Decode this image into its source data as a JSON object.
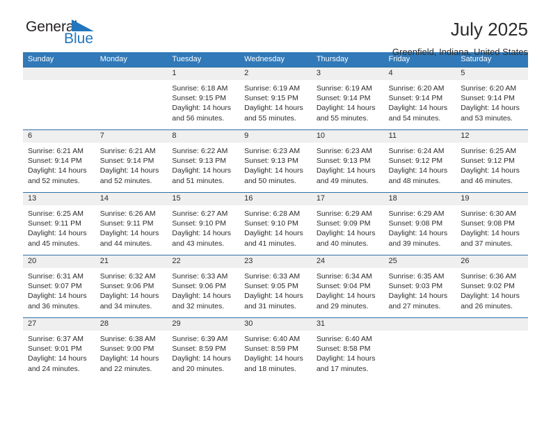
{
  "brand": {
    "name_part1": "General",
    "name_part2": "Blue",
    "triangle_icon": "triangle-icon",
    "accent_color": "#2176bd"
  },
  "header": {
    "title": "July 2025",
    "subtitle": "Greenfield, Indiana, United States"
  },
  "calendar": {
    "header_bg": "#3179b8",
    "daynum_bg": "#efefef",
    "row_border": "#2f6fa8",
    "weekday_headers": [
      "Sunday",
      "Monday",
      "Tuesday",
      "Wednesday",
      "Thursday",
      "Friday",
      "Saturday"
    ],
    "weeks": [
      [
        {
          "day": "",
          "empty": true
        },
        {
          "day": "",
          "empty": true
        },
        {
          "day": "1",
          "sunrise": "Sunrise: 6:18 AM",
          "sunset": "Sunset: 9:15 PM",
          "daylight": "Daylight: 14 hours and 56 minutes."
        },
        {
          "day": "2",
          "sunrise": "Sunrise: 6:19 AM",
          "sunset": "Sunset: 9:15 PM",
          "daylight": "Daylight: 14 hours and 55 minutes."
        },
        {
          "day": "3",
          "sunrise": "Sunrise: 6:19 AM",
          "sunset": "Sunset: 9:14 PM",
          "daylight": "Daylight: 14 hours and 55 minutes."
        },
        {
          "day": "4",
          "sunrise": "Sunrise: 6:20 AM",
          "sunset": "Sunset: 9:14 PM",
          "daylight": "Daylight: 14 hours and 54 minutes."
        },
        {
          "day": "5",
          "sunrise": "Sunrise: 6:20 AM",
          "sunset": "Sunset: 9:14 PM",
          "daylight": "Daylight: 14 hours and 53 minutes."
        }
      ],
      [
        {
          "day": "6",
          "sunrise": "Sunrise: 6:21 AM",
          "sunset": "Sunset: 9:14 PM",
          "daylight": "Daylight: 14 hours and 52 minutes."
        },
        {
          "day": "7",
          "sunrise": "Sunrise: 6:21 AM",
          "sunset": "Sunset: 9:14 PM",
          "daylight": "Daylight: 14 hours and 52 minutes."
        },
        {
          "day": "8",
          "sunrise": "Sunrise: 6:22 AM",
          "sunset": "Sunset: 9:13 PM",
          "daylight": "Daylight: 14 hours and 51 minutes."
        },
        {
          "day": "9",
          "sunrise": "Sunrise: 6:23 AM",
          "sunset": "Sunset: 9:13 PM",
          "daylight": "Daylight: 14 hours and 50 minutes."
        },
        {
          "day": "10",
          "sunrise": "Sunrise: 6:23 AM",
          "sunset": "Sunset: 9:13 PM",
          "daylight": "Daylight: 14 hours and 49 minutes."
        },
        {
          "day": "11",
          "sunrise": "Sunrise: 6:24 AM",
          "sunset": "Sunset: 9:12 PM",
          "daylight": "Daylight: 14 hours and 48 minutes."
        },
        {
          "day": "12",
          "sunrise": "Sunrise: 6:25 AM",
          "sunset": "Sunset: 9:12 PM",
          "daylight": "Daylight: 14 hours and 46 minutes."
        }
      ],
      [
        {
          "day": "13",
          "sunrise": "Sunrise: 6:25 AM",
          "sunset": "Sunset: 9:11 PM",
          "daylight": "Daylight: 14 hours and 45 minutes."
        },
        {
          "day": "14",
          "sunrise": "Sunrise: 6:26 AM",
          "sunset": "Sunset: 9:11 PM",
          "daylight": "Daylight: 14 hours and 44 minutes."
        },
        {
          "day": "15",
          "sunrise": "Sunrise: 6:27 AM",
          "sunset": "Sunset: 9:10 PM",
          "daylight": "Daylight: 14 hours and 43 minutes."
        },
        {
          "day": "16",
          "sunrise": "Sunrise: 6:28 AM",
          "sunset": "Sunset: 9:10 PM",
          "daylight": "Daylight: 14 hours and 41 minutes."
        },
        {
          "day": "17",
          "sunrise": "Sunrise: 6:29 AM",
          "sunset": "Sunset: 9:09 PM",
          "daylight": "Daylight: 14 hours and 40 minutes."
        },
        {
          "day": "18",
          "sunrise": "Sunrise: 6:29 AM",
          "sunset": "Sunset: 9:08 PM",
          "daylight": "Daylight: 14 hours and 39 minutes."
        },
        {
          "day": "19",
          "sunrise": "Sunrise: 6:30 AM",
          "sunset": "Sunset: 9:08 PM",
          "daylight": "Daylight: 14 hours and 37 minutes."
        }
      ],
      [
        {
          "day": "20",
          "sunrise": "Sunrise: 6:31 AM",
          "sunset": "Sunset: 9:07 PM",
          "daylight": "Daylight: 14 hours and 36 minutes."
        },
        {
          "day": "21",
          "sunrise": "Sunrise: 6:32 AM",
          "sunset": "Sunset: 9:06 PM",
          "daylight": "Daylight: 14 hours and 34 minutes."
        },
        {
          "day": "22",
          "sunrise": "Sunrise: 6:33 AM",
          "sunset": "Sunset: 9:06 PM",
          "daylight": "Daylight: 14 hours and 32 minutes."
        },
        {
          "day": "23",
          "sunrise": "Sunrise: 6:33 AM",
          "sunset": "Sunset: 9:05 PM",
          "daylight": "Daylight: 14 hours and 31 minutes."
        },
        {
          "day": "24",
          "sunrise": "Sunrise: 6:34 AM",
          "sunset": "Sunset: 9:04 PM",
          "daylight": "Daylight: 14 hours and 29 minutes."
        },
        {
          "day": "25",
          "sunrise": "Sunrise: 6:35 AM",
          "sunset": "Sunset: 9:03 PM",
          "daylight": "Daylight: 14 hours and 27 minutes."
        },
        {
          "day": "26",
          "sunrise": "Sunrise: 6:36 AM",
          "sunset": "Sunset: 9:02 PM",
          "daylight": "Daylight: 14 hours and 26 minutes."
        }
      ],
      [
        {
          "day": "27",
          "sunrise": "Sunrise: 6:37 AM",
          "sunset": "Sunset: 9:01 PM",
          "daylight": "Daylight: 14 hours and 24 minutes."
        },
        {
          "day": "28",
          "sunrise": "Sunrise: 6:38 AM",
          "sunset": "Sunset: 9:00 PM",
          "daylight": "Daylight: 14 hours and 22 minutes."
        },
        {
          "day": "29",
          "sunrise": "Sunrise: 6:39 AM",
          "sunset": "Sunset: 8:59 PM",
          "daylight": "Daylight: 14 hours and 20 minutes."
        },
        {
          "day": "30",
          "sunrise": "Sunrise: 6:40 AM",
          "sunset": "Sunset: 8:59 PM",
          "daylight": "Daylight: 14 hours and 18 minutes."
        },
        {
          "day": "31",
          "sunrise": "Sunrise: 6:40 AM",
          "sunset": "Sunset: 8:58 PM",
          "daylight": "Daylight: 14 hours and 17 minutes."
        },
        {
          "day": "",
          "empty": true
        },
        {
          "day": "",
          "empty": true
        }
      ]
    ]
  }
}
